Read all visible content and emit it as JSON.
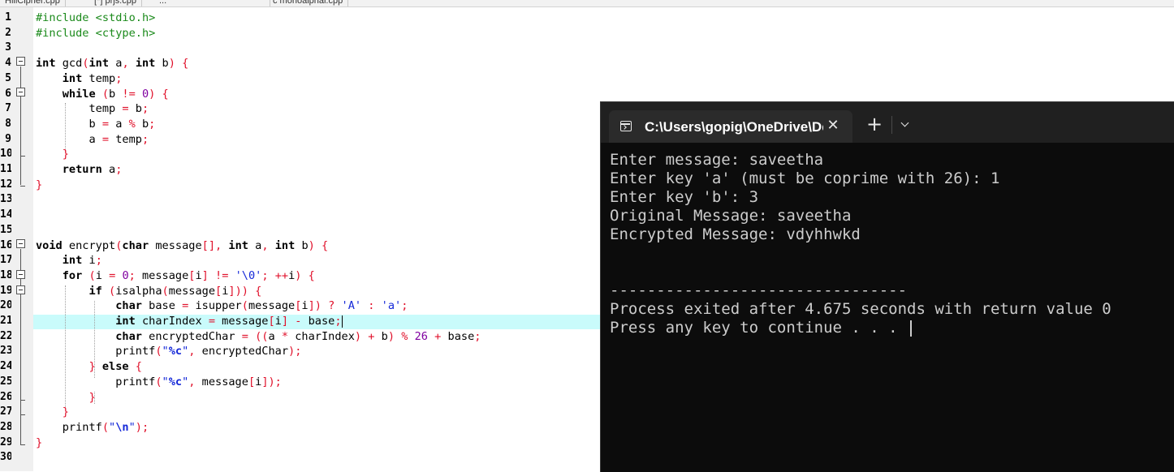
{
  "editor": {
    "tabs": [
      "HillCipher.cpp",
      "[*] prjs.cpp",
      "...",
      "c monoalphal.cpp"
    ],
    "line_numbers": [
      "1",
      "2",
      "3",
      "4",
      "5",
      "6",
      "7",
      "8",
      "9",
      "10",
      "11",
      "12",
      "13",
      "14",
      "15",
      "16",
      "17",
      "18",
      "19",
      "20",
      "21",
      "22",
      "23",
      "24",
      "25",
      "26",
      "27",
      "28",
      "29",
      "30"
    ],
    "code_text": [
      "#include <stdio.h>",
      "#include <ctype.h>",
      "",
      "int gcd(int a, int b) {",
      "    int temp;",
      "    while (b != 0) {",
      "        temp = b;",
      "        b = a % b;",
      "        a = temp;",
      "    }",
      "    return a;",
      "}",
      "",
      "",
      "",
      "void encrypt(char message[], int a, int b) {",
      "    int i;",
      "    for (i = 0; message[i] != '\\0'; ++i) {",
      "        if (isalpha(message[i])) {",
      "            char base = isupper(message[i]) ? 'A' : 'a';",
      "            int charIndex = message[i] - base;",
      "            char encryptedChar = ((a * charIndex) + b) % 26 + base;",
      "            printf(\"%c\", encryptedChar);",
      "        } else {",
      "            printf(\"%c\", message[i]);",
      "        }",
      "    }",
      "    printf(\"\\n\");",
      "}",
      ""
    ],
    "highlighted_line": "21"
  },
  "terminal": {
    "tab_title": "C:\\Users\\gopig\\OneDrive\\Desktop",
    "new_tab_label": "+",
    "close_label": "✕",
    "output": [
      "Enter message: saveetha",
      "Enter key 'a' (must be coprime with 26): 1",
      "Enter key 'b': 3",
      "Original Message: saveetha",
      "Encrypted Message: vdyhhwkd",
      "",
      "",
      "--------------------------------",
      "Process exited after 4.675 seconds with return value 0",
      "Press any key to continue . . . "
    ]
  },
  "colors": {
    "preprocessor": "#1b8a1b",
    "operator": "#e0102a",
    "number": "#8000a0",
    "string": "#1428d8",
    "highlight": "#c9fbfb",
    "terminal_bg": "#0c0c0c"
  }
}
